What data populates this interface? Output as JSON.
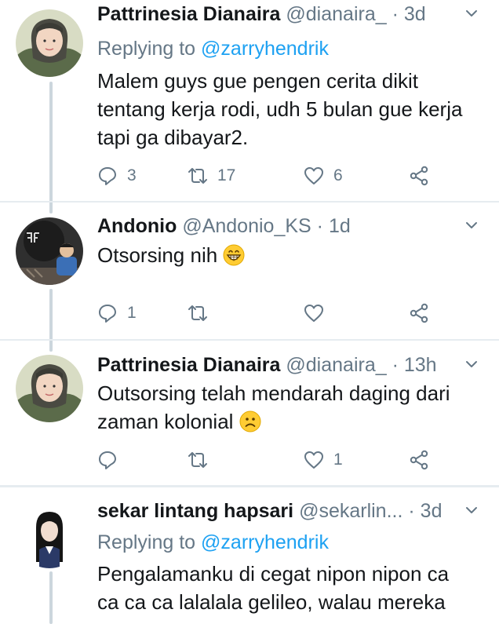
{
  "colors": {
    "accent": "#1da1f2",
    "muted": "#657786",
    "text": "#14171a",
    "divider": "#e6ecf0"
  },
  "tweets": [
    {
      "name": "Pattrinesia Dianaira",
      "handle": "@dianaira_",
      "dot": "·",
      "time": "3d",
      "replying_label": "Replying to",
      "replying_handle": "@zarryhendrik",
      "lines": [
        "Malem guys gue pengen cerita dikit",
        "tentang kerja rodi, udh 5 bulan gue kerja",
        "tapi ga dibayar2."
      ],
      "replies": "3",
      "retweets": "17",
      "likes": "6"
    },
    {
      "name": "Andonio",
      "handle": "@Andonio_KS",
      "dot": "·",
      "time": "1d",
      "lines": [
        "Otsorsing nih"
      ],
      "emoji": "grinning-face",
      "replies": "1",
      "retweets": "",
      "likes": ""
    },
    {
      "name": "Pattrinesia Dianaira",
      "handle": "@dianaira_",
      "dot": "·",
      "time": "13h",
      "lines": [
        "Outsorsing telah mendarah daging dari",
        "zaman kolonial"
      ],
      "emoji": "frowning-face",
      "replies": "",
      "retweets": "",
      "likes": "1"
    },
    {
      "name": "sekar lintang hapsari",
      "handle": "@sekarlin...",
      "dot": "·",
      "time": "3d",
      "replying_label": "Replying to",
      "replying_handle": "@zarryhendrik",
      "lines": [
        "Pengalamanku di cegat nipon nipon ca",
        "ca ca ca lalalala gelileo, walau mereka"
      ],
      "replies": "",
      "retweets": "",
      "likes": ""
    }
  ]
}
